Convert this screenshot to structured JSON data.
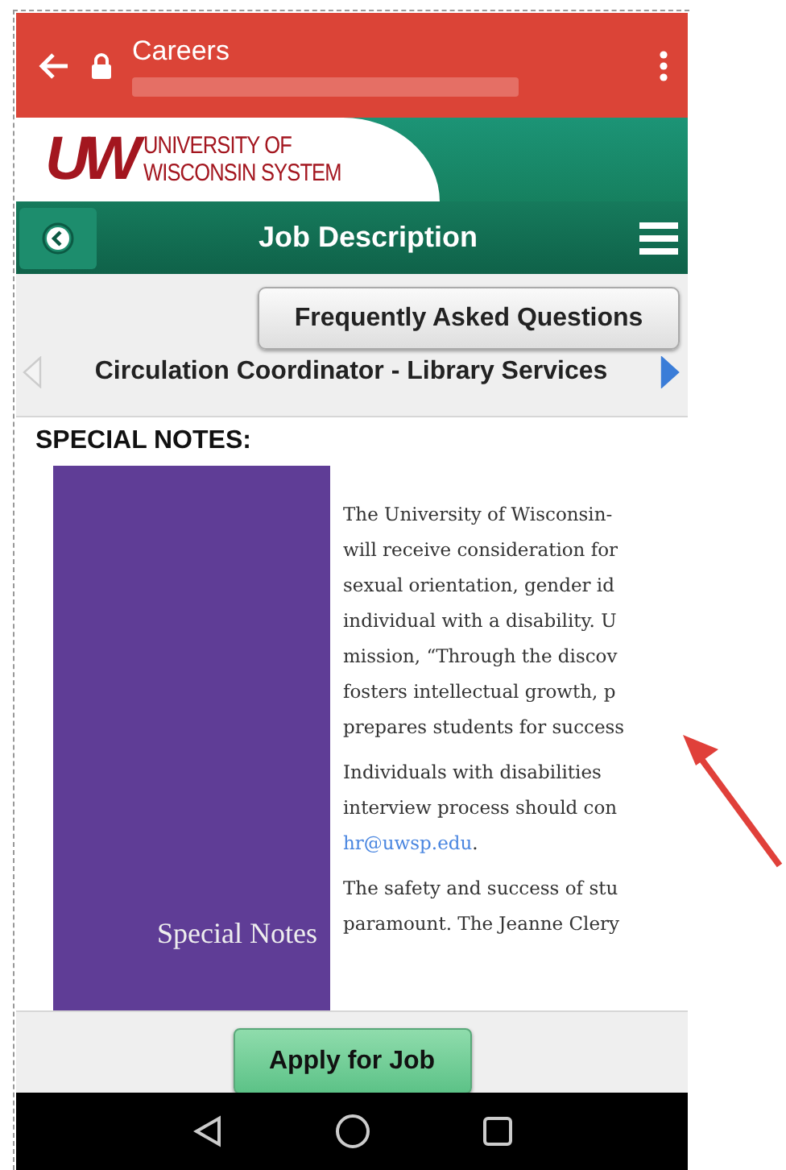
{
  "browser_bar": {
    "title": "Careers"
  },
  "header": {
    "mark": "UW",
    "logo_lines": [
      "UNIVERSITY OF",
      "WISCONSIN SYSTEM"
    ]
  },
  "nav_bar": {
    "title": "Job Description"
  },
  "faq_button": "Frequently Asked Questions",
  "job_nav": {
    "title": "Circulation Coordinator - Library Services",
    "prev": {
      "disabled": true
    },
    "next": {
      "disabled": false
    }
  },
  "section_heading": "SPECIAL NOTES:",
  "side_label": "Special Notes",
  "paragraphs": [
    [
      {
        "kind": "text",
        "text": "The University of Wisconsin-"
      },
      {
        "kind": "text",
        "text": "will receive consideration for"
      },
      {
        "kind": "text",
        "text": "sexual orientation, gender id"
      },
      {
        "kind": "text",
        "text": "individual with a disability. U"
      },
      {
        "kind": "text",
        "text": "mission, “Through the discov"
      },
      {
        "kind": "text",
        "text": "fosters intellectual growth, p"
      },
      {
        "kind": "text",
        "text": "prepares students for success"
      }
    ],
    [
      {
        "kind": "text",
        "text": "Individuals with disabilities"
      },
      {
        "kind": "text",
        "text": "interview process should con"
      },
      {
        "kind": "link",
        "text": "hr@uwsp.edu",
        "after": "."
      }
    ],
    [
      {
        "kind": "text",
        "text": "The safety and success of stu"
      },
      {
        "kind": "text",
        "text": "paramount. The Jeanne Clery"
      }
    ]
  ],
  "apply_button": "Apply for Job"
}
